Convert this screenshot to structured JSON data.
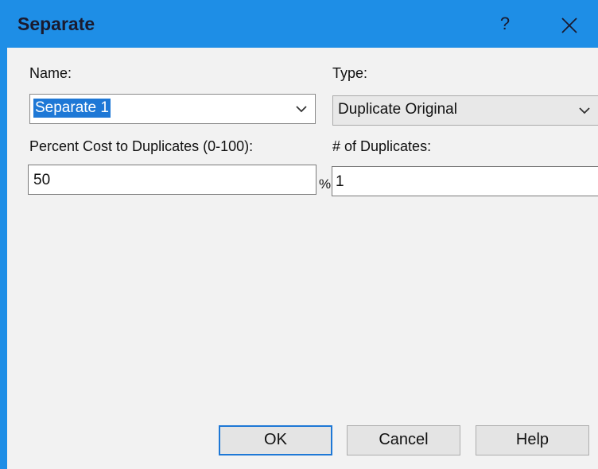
{
  "window": {
    "title": "Separate",
    "help_glyph": "?",
    "close_icon": "close-icon",
    "accent_color": "#1e8ee6"
  },
  "fields": {
    "name_label": "Name:",
    "name_value": "Separate 1",
    "type_label": "Type:",
    "type_value": "Duplicate Original",
    "percent_label": "Percent Cost to Duplicates (0-100):",
    "percent_value": "50",
    "percent_unit": "%",
    "duplicates_label": "# of Duplicates:",
    "duplicates_value": "1"
  },
  "buttons": {
    "ok": "OK",
    "cancel": "Cancel",
    "help": "Help"
  }
}
